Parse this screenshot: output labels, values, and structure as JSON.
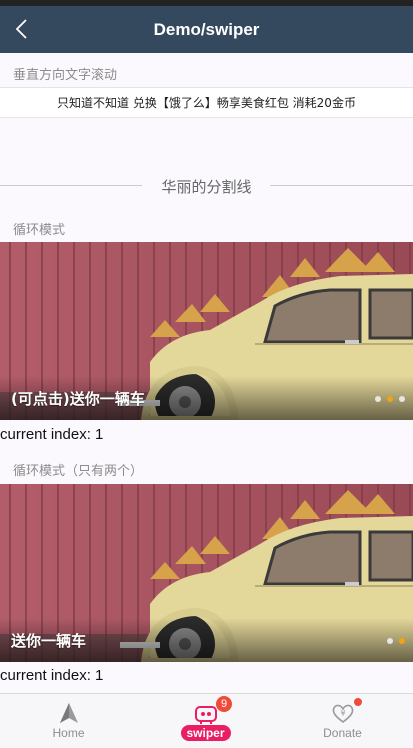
{
  "header": {
    "title": "Demo/swiper"
  },
  "sections": {
    "vertical_title": "垂直方向文字滚动",
    "marquee_text": "只知道不知道 兑换【饿了么】畅享美食红包 消耗20金币",
    "divider_text": "华丽的分割线",
    "loop_title": "循环模式",
    "loop_two_title": "循环模式（只有两个）"
  },
  "swiper1": {
    "caption": "(可点击)送你一辆车",
    "index_text": "current index: 1",
    "dots": 3,
    "active_dot": 2
  },
  "swiper2": {
    "caption": "送你一辆车",
    "index_text": "current index: 1",
    "dots": 2,
    "active_dot": 2
  },
  "tabbar": {
    "tabs": [
      {
        "label": "Home",
        "icon": "navigation-arrow-icon",
        "active": false
      },
      {
        "label": "swiper",
        "icon": "robot-icon",
        "active": true,
        "badge": "9"
      },
      {
        "label": "Donate",
        "icon": "heart-money-icon",
        "active": false,
        "dot": true
      }
    ]
  },
  "colors": {
    "header_bg": "#35495e",
    "active_tab": "#e91e63",
    "badge": "#f04a3a",
    "active_dot": "#f0a21b"
  }
}
